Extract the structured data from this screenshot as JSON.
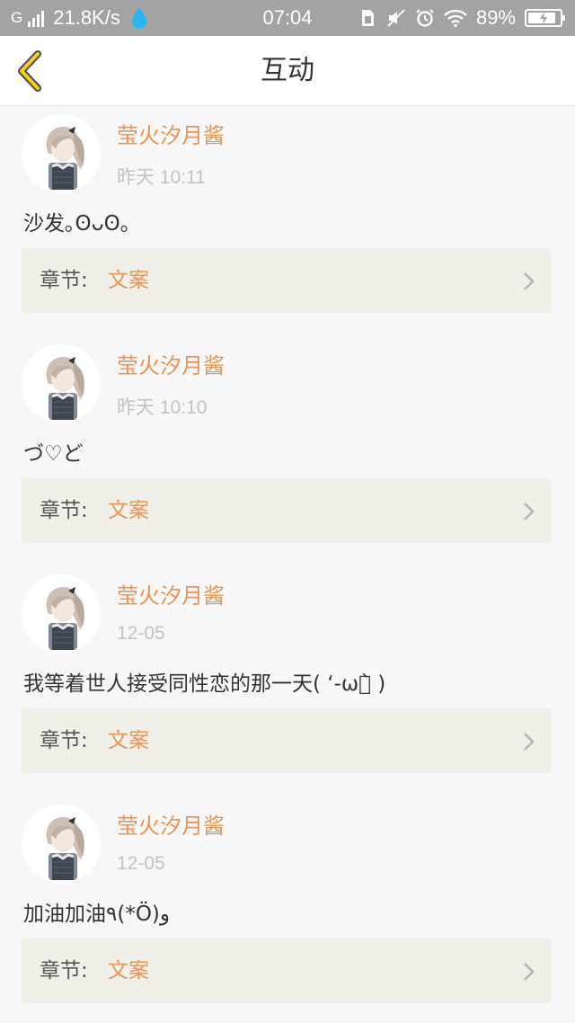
{
  "status_bar": {
    "network": "G",
    "speed": "21.8K/s",
    "time": "07:04",
    "battery_percent": "89%",
    "battery_level": 0.89
  },
  "header": {
    "title": "互动",
    "back_icon": "chevron-left-icon",
    "accent_color": "#e8c523"
  },
  "colors": {
    "username": "#e8955c",
    "chapter_name": "#e8955c",
    "chapter_bg": "#f0efe8"
  },
  "comments": [
    {
      "username": "莹火汐月酱",
      "time": "昨天 10:11",
      "text": "沙发｡ʘᴗʘ｡",
      "chapter_label": "章节:",
      "chapter_name": "文案"
    },
    {
      "username": "莹火汐月酱",
      "time": "昨天 10:10",
      "text": "づ♡ど",
      "chapter_label": "章节:",
      "chapter_name": "文案"
    },
    {
      "username": "莹火汐月酱",
      "time": "12-05",
      "text": "我等着世人接受同性恋的那一天( ‘-ωก̀ )",
      "chapter_label": "章节:",
      "chapter_name": "文案"
    },
    {
      "username": "莹火汐月酱",
      "time": "12-05",
      "text": "加油加油٩(*Ö)و",
      "chapter_label": "章节:",
      "chapter_name": "文案"
    }
  ]
}
